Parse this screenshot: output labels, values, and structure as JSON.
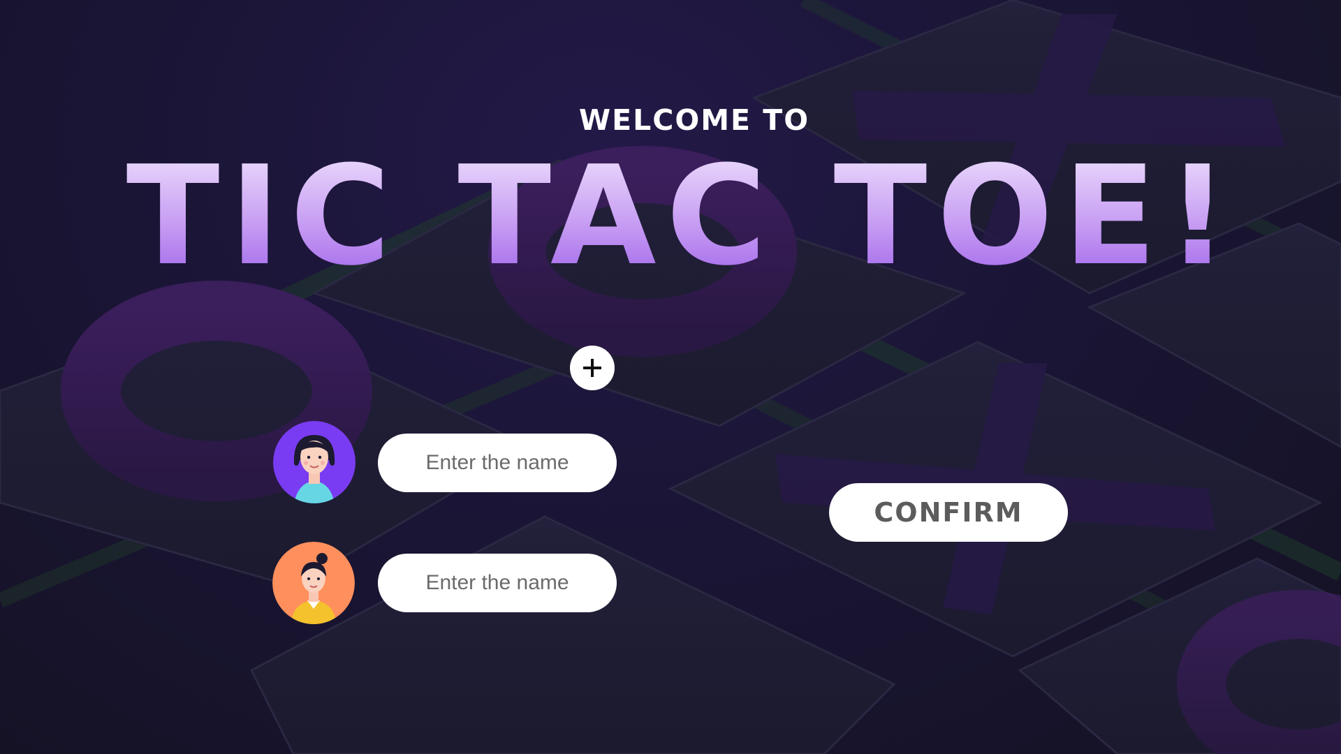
{
  "screen": {
    "welcome_text": "WELCOME TO",
    "title": "TIC TAC TOE!"
  },
  "players": [
    {
      "avatar_icon": "player-one-avatar-icon",
      "input_placeholder": "Enter the name",
      "input_value": ""
    },
    {
      "avatar_icon": "player-two-avatar-icon",
      "input_placeholder": "Enter the name",
      "input_value": ""
    }
  ],
  "add_player": {
    "icon": "plus-icon"
  },
  "confirm": {
    "label": "CONFIRM"
  },
  "colors": {
    "background": "#15132b",
    "title_gradient_top": "#e6d2fb",
    "title_gradient_bottom": "#a065ea",
    "button_bg": "#ffffff",
    "button_text": "#5c5c5c",
    "avatar_one_bg": "#7a3cf2",
    "avatar_two_bg": "#ff8f5c"
  }
}
